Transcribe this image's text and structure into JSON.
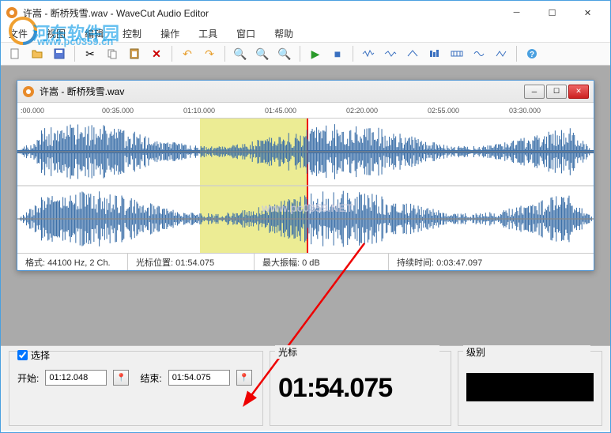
{
  "window": {
    "title": "许嵩 - 断桥残雪.wav - WaveCut Audio Editor"
  },
  "menu": {
    "file": "文件",
    "view": "视图",
    "edit": "编辑",
    "control": "控制",
    "operate": "操作",
    "tool": "工具",
    "window": "窗口",
    "help": "帮助"
  },
  "doc": {
    "title": "许嵩 - 断桥残雪.wav"
  },
  "timeline": {
    "t0": ":00.000",
    "t1": "00:35.000",
    "t2": "01:10.000",
    "t3": "01:45.000",
    "t4": "02:20.000",
    "t5": "02:55.000",
    "t6": "03:30.000"
  },
  "status": {
    "format_label": "格式:",
    "format_value": "44100 Hz, 2 Ch.",
    "cursor_label": "光标位置:",
    "cursor_value": "01:54.075",
    "maxamp_label": "最大振幅:",
    "maxamp_value": "0 dB",
    "duration_label": "持续时间:",
    "duration_value": "0:03:47.097"
  },
  "panel": {
    "select_label": "选择",
    "start_label": "开始:",
    "start_value": "01:12.048",
    "end_label": "结束:",
    "end_value": "01:54.075",
    "cursor_label": "光标",
    "cursor_big": "01:54.075",
    "level_label": "级别"
  },
  "watermark": {
    "site_cn": "河东软件园",
    "site_url": "www.pc0359.cn",
    "center": "www.pc0359.NET"
  }
}
